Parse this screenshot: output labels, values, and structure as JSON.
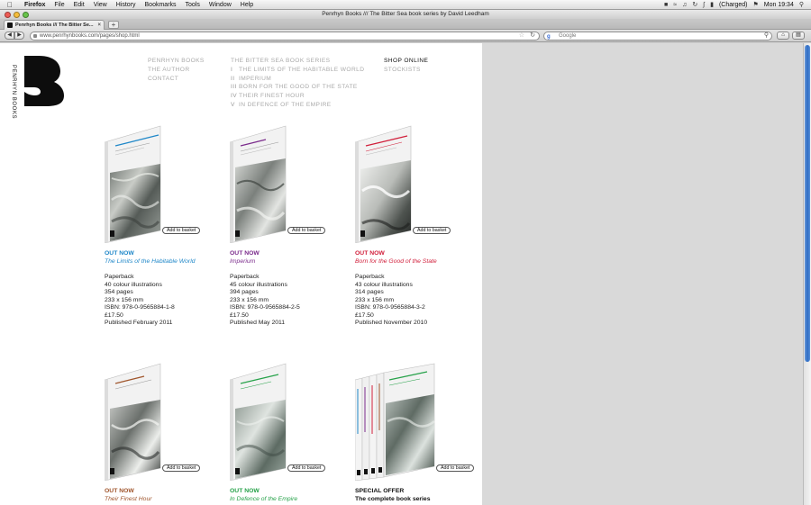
{
  "menubar": {
    "app_name": "Firefox",
    "menus": [
      "File",
      "Edit",
      "View",
      "History",
      "Bookmarks",
      "Tools",
      "Window",
      "Help"
    ],
    "battery_status": "(Charged)",
    "clock": "Mon 19:34"
  },
  "window": {
    "title": "Penrhyn Books /// The Bitter Sea book series by David Leedham"
  },
  "tab": {
    "label": "Penrhyn Books /// The Bitter Se..."
  },
  "urlbar": {
    "url": "www.penrhynbooks.com/pages/shop.html"
  },
  "searchbar": {
    "placeholder": "Google"
  },
  "brand": {
    "vertical_text": "PENRHYN BOOKS",
    "logo_letter": "B"
  },
  "nav": {
    "col1": [
      "PENRHYN BOOKS",
      "THE AUTHOR",
      "CONTACT"
    ],
    "col2_title": "THE BITTER SEA BOOK SERIES",
    "col2": [
      {
        "numeral": "I",
        "label": "THE LIMITS OF THE HABITABLE WORLD"
      },
      {
        "numeral": "II",
        "label": "IMPERIUM"
      },
      {
        "numeral": "III",
        "label": "BORN FOR THE GOOD OF THE STATE"
      },
      {
        "numeral": "IV",
        "label": "THEIR FINEST HOUR"
      },
      {
        "numeral": "V",
        "label": "IN DEFENCE OF THE EMPIRE"
      }
    ],
    "col3": [
      "SHOP ONLINE",
      "STOCKISTS"
    ]
  },
  "products": [
    {
      "status": "OUT NOW",
      "title": "The Limits of the Habitable World",
      "color": "#1f87c8",
      "button": "Add to basket",
      "details": [
        "Paperback",
        "40 colour illustrations",
        "354 pages",
        "233 x 156 mm",
        "ISBN: 978-0-9565884-1-8",
        "£17.50",
        "Published February 2011"
      ]
    },
    {
      "status": "OUT NOW",
      "title": "Imperium",
      "color": "#7b2c8c",
      "button": "Add to basket",
      "details": [
        "Paperback",
        "45 colour illustrations",
        "394 pages",
        "233 x 156 mm",
        "ISBN: 978-0-9565884-2-5",
        "£17.50",
        "Published May 2011"
      ]
    },
    {
      "status": "OUT NOW",
      "title": "Born for the Good of the State",
      "color": "#d11f3b",
      "button": "Add to basket",
      "details": [
        "Paperback",
        "43 colour illustrations",
        "314 pages",
        "233 x 156 mm",
        "ISBN: 978-0-9565884-3-2",
        "£17.50",
        "Published November 2010"
      ]
    },
    {
      "status": "OUT NOW",
      "title": "Their Finest Hour",
      "color": "#a0552c",
      "button": "Add to basket"
    },
    {
      "status": "OUT NOW",
      "title": "In Defence of the Empire",
      "color": "#27a24a",
      "button": "Add to basket"
    },
    {
      "status": "SPECIAL OFFER",
      "title": "The complete book series",
      "color": "#111111",
      "button": "Add to basket"
    }
  ]
}
